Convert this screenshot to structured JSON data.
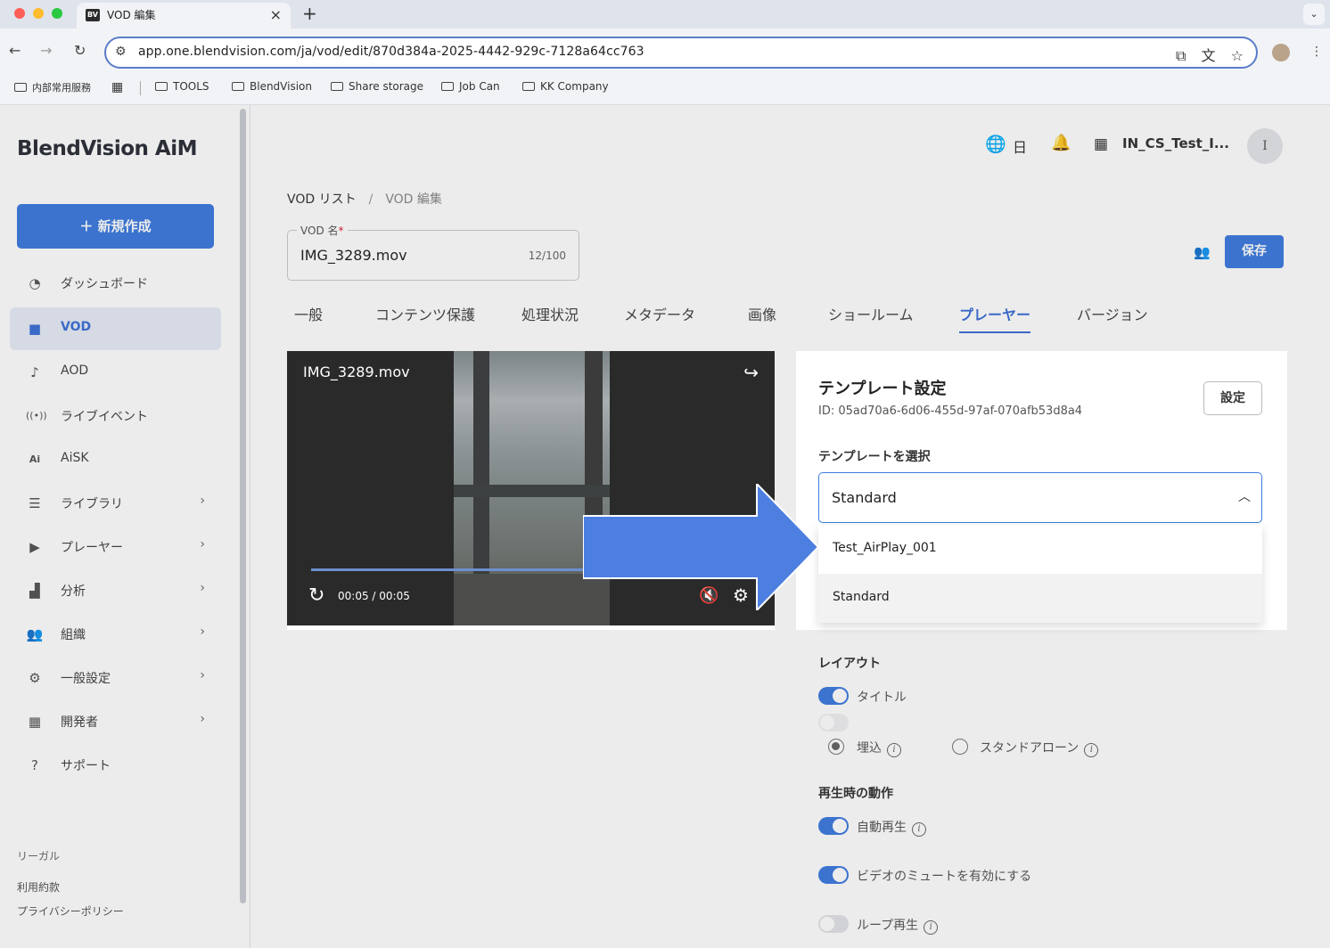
{
  "browser": {
    "tab_title": "VOD 編集",
    "favicon_text": "BV",
    "url": "app.one.blendvision.com/ja/vod/edit/870d384a-2025-4442-929c-7128a64cc763",
    "bookmarks": [
      "内部常用服務",
      "TOOLS",
      "BlendVision",
      "Share storage",
      "Job Can",
      "KK Company"
    ]
  },
  "sidebar": {
    "logo": "BlendVision AiM",
    "create_label": "＋ 新規作成",
    "items": [
      {
        "label": "ダッシュボード",
        "icon": "gauge-icon",
        "chevron": false
      },
      {
        "label": "VOD",
        "icon": "video-icon",
        "chevron": false,
        "active": true
      },
      {
        "label": "AOD",
        "icon": "audio-icon",
        "chevron": false
      },
      {
        "label": "ライブイベント",
        "icon": "broadcast-icon",
        "chevron": false
      },
      {
        "label": "AiSK",
        "icon": "ai-icon",
        "chevron": false
      },
      {
        "label": "ライブラリ",
        "icon": "library-icon",
        "chevron": true
      },
      {
        "label": "プレーヤー",
        "icon": "player-icon",
        "chevron": true
      },
      {
        "label": "分析",
        "icon": "chart-icon",
        "chevron": true
      },
      {
        "label": "組織",
        "icon": "org-icon",
        "chevron": true
      },
      {
        "label": "一般設定",
        "icon": "gear-icon",
        "chevron": true
      },
      {
        "label": "開発者",
        "icon": "developer-icon",
        "chevron": true
      },
      {
        "label": "サポート",
        "icon": "help-icon",
        "chevron": false
      }
    ],
    "footer": {
      "legal": "リーガル",
      "terms": "利用約款",
      "privacy": "プライバシーポリシー"
    }
  },
  "header": {
    "language": "日",
    "org_name": "IN_CS_Test_I...",
    "avatar_initial": "I"
  },
  "breadcrumb": {
    "root": "VOD リスト",
    "separator": "/",
    "current": "VOD 編集"
  },
  "vod_name": {
    "label": "VOD 名",
    "required": "*",
    "value": "IMG_3289.mov",
    "count": "12/100"
  },
  "save_label": "保存",
  "tabs": [
    "一般",
    "コンテンツ保護",
    "処理状況",
    "メタデータ",
    "画像",
    "ショールーム",
    "プレーヤー",
    "バージョン"
  ],
  "active_tab": "プレーヤー",
  "player": {
    "title": "IMG_3289.mov",
    "time": "00:05 / 00:05",
    "progress": 1.0
  },
  "template": {
    "title": "テンプレート設定",
    "id": "ID: 05ad70a6-6d06-455d-97af-070afb53d8a4",
    "settings_label": "設定",
    "select_label": "テンプレートを選択",
    "selected": "Standard",
    "options": [
      "Test_AirPlay_001",
      "Standard"
    ]
  },
  "layout": {
    "label": "レイアウト",
    "title_toggle": "タイトル",
    "radio_embed": "埋込",
    "radio_standalone": "スタンドアローン"
  },
  "playback": {
    "label": "再生時の動作",
    "autoplay": "自動再生",
    "mute": "ビデオのミュートを有効にする",
    "loop": "ループ再生"
  },
  "colors": {
    "accent": "#3d7be0",
    "arrow": "#4d7fe0"
  }
}
